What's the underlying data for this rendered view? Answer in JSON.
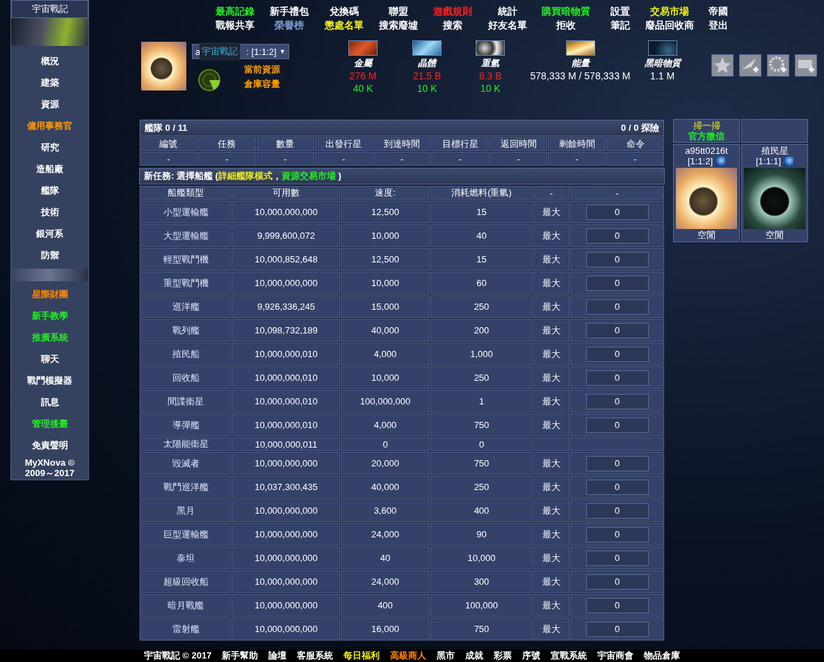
{
  "sidebar": {
    "title": "宇宙戰記",
    "items": [
      {
        "label": "概況",
        "color": "#ffffff"
      },
      {
        "label": "建築",
        "color": "#ffffff"
      },
      {
        "label": "資源",
        "color": "#ffffff"
      },
      {
        "label": "傭用事務官",
        "color": "#ff9900"
      },
      {
        "label": "研究",
        "color": "#ffffff"
      },
      {
        "label": "造船廠",
        "color": "#ffffff"
      },
      {
        "label": "艦隊",
        "color": "#ffffff"
      },
      {
        "label": "技術",
        "color": "#ffffff"
      },
      {
        "label": "銀河系",
        "color": "#ffffff"
      },
      {
        "label": "防禦",
        "color": "#ffffff"
      }
    ],
    "items_2": [
      {
        "label": "星際財團",
        "color": "#ff8800"
      },
      {
        "label": "新手教學",
        "color": "#22ee22"
      },
      {
        "label": "推廣系統",
        "color": "#22ee22"
      },
      {
        "label": "聊天",
        "color": "#ffffff"
      },
      {
        "label": "戰鬥模擬器",
        "color": "#ffffff"
      },
      {
        "label": "訊息",
        "color": "#ffffff"
      },
      {
        "label": "管理後臺",
        "color": "#22ee22"
      },
      {
        "label": "免責聲明",
        "color": "#ffffff"
      }
    ],
    "copyright": [
      "MyXNova ©",
      "2009～2017"
    ]
  },
  "top_nav": [
    [
      {
        "label": "最高記錄",
        "color": "#22ee22"
      },
      {
        "label": "新手禮包",
        "color": "#ffffff"
      },
      {
        "label": "兌換碼",
        "color": "#ffffff"
      },
      {
        "label": "聯盟",
        "color": "#ffffff"
      },
      {
        "label": "遊戲規則",
        "color": "#ff2222"
      },
      {
        "label": "統計",
        "color": "#ffffff"
      },
      {
        "label": "購買暗物質",
        "color": "#22ee22"
      },
      {
        "label": "設置",
        "color": "#ffffff"
      },
      {
        "label": "交易市場",
        "color": "#eeee22"
      },
      {
        "label": "帝國",
        "color": "#ffffff"
      }
    ],
    [
      {
        "label": "戰報共享",
        "color": "#ffffff"
      },
      {
        "label": "榮譽榜",
        "color": "#7799cc"
      },
      {
        "label": "懲處名單",
        "color": "#eeee22"
      },
      {
        "label": "搜索廢墟",
        "color": "#ffffff"
      },
      {
        "label": "搜索",
        "color": "#ffffff"
      },
      {
        "label": "好友名單",
        "color": "#ffffff"
      },
      {
        "label": "拒收",
        "color": "#ffffff"
      },
      {
        "label": "筆記",
        "color": "#ffffff"
      },
      {
        "label": "廢品回收商",
        "color": "#ffffff"
      },
      {
        "label": "登出",
        "color": "#ffffff"
      }
    ]
  ],
  "planet_select": {
    "value_start": "a",
    "value_end": ": [1:1:2]",
    "caret": "▼",
    "tooltip": "宇宙戰記"
  },
  "resource_labels": [
    "當前資源",
    "倉庫容量"
  ],
  "resources": [
    {
      "kind": "metal",
      "name": "金屬",
      "amount": "276 M",
      "over_capacity": true,
      "capacity": "40 K"
    },
    {
      "kind": "crystal",
      "name": "晶體",
      "amount": "21.5 B",
      "over_capacity": true,
      "capacity": "10 K"
    },
    {
      "kind": "deuterium",
      "name": "重氫",
      "amount": "8.3 B",
      "over_capacity": true,
      "capacity": "10 K"
    },
    {
      "kind": "energy",
      "name": "能量",
      "amount": "578,333 M / 578,333 M",
      "over_capacity": false
    },
    {
      "kind": "darkmatter",
      "name": "黑暗物質",
      "amount": "1.1 M",
      "over_capacity": false
    }
  ],
  "fleet": {
    "title": "艦隊 0 / 11",
    "expeditions": "0 / 0 探險",
    "columns": [
      "編號",
      "任務",
      "數量",
      "出發行星",
      "到達時間",
      "目標行星",
      "返回時間",
      "剩餘時間",
      "命令"
    ],
    "row": [
      "-",
      "-",
      "-",
      "-",
      "-",
      "-",
      "-",
      "-",
      "-"
    ]
  },
  "new_mission": {
    "label": "新任務: 選擇船艦 (",
    "link_1": "詳細艦隊模式",
    "separator": "，",
    "link_2": "資源交易市場",
    "end": ")"
  },
  "ships": {
    "columns": [
      "船艦類型",
      "可用數",
      "速度:",
      "消耗燃料(重氫)",
      "-",
      "-"
    ],
    "rows": [
      {
        "kind": "input",
        "name": "小型運輸艦",
        "available": "10,000,000,000",
        "speed": "12,500",
        "fuel": "15",
        "max": "最大",
        "value": "0"
      },
      {
        "kind": "input",
        "name": "大型運輸艦",
        "available": "9,999,600,072",
        "speed": "10,000",
        "fuel": "40",
        "max": "最大",
        "value": "0"
      },
      {
        "kind": "input",
        "name": "輕型戰鬥機",
        "available": "10,000,852,648",
        "speed": "12,500",
        "fuel": "15",
        "max": "最大",
        "value": "0"
      },
      {
        "kind": "input",
        "name": "重型戰鬥機",
        "available": "10,000,000,000",
        "speed": "10,000",
        "fuel": "60",
        "max": "最大",
        "value": "0"
      },
      {
        "kind": "input",
        "name": "巡洋艦",
        "available": "9,926,336,245",
        "speed": "15,000",
        "fuel": "250",
        "max": "最大",
        "value": "0"
      },
      {
        "kind": "input",
        "name": "戰列艦",
        "available": "10,098,732,189",
        "speed": "40,000",
        "fuel": "200",
        "max": "最大",
        "value": "0"
      },
      {
        "kind": "input",
        "name": "殖民船",
        "available": "10,000,000,010",
        "speed": "4,000",
        "fuel": "1,000",
        "max": "最大",
        "value": "0"
      },
      {
        "kind": "input",
        "name": "回收船",
        "available": "10,000,000,010",
        "speed": "10,000",
        "fuel": "250",
        "max": "最大",
        "value": "0"
      },
      {
        "kind": "input",
        "name": "間諜衛星",
        "available": "10,000,000,010",
        "speed": "100,000,000",
        "fuel": "1",
        "max": "最大",
        "value": "0"
      },
      {
        "kind": "input",
        "name": "導彈艦",
        "available": "10,000,000,010",
        "speed": "4,000",
        "fuel": "750",
        "max": "最大",
        "value": "0"
      },
      {
        "kind": "static",
        "name": "太陽能衛星",
        "available": "10,000,000,011",
        "speed": "0",
        "fuel": "0"
      },
      {
        "kind": "input",
        "name": "毀滅者",
        "available": "10,000,000,000",
        "speed": "20,000",
        "fuel": "750",
        "max": "最大",
        "value": "0"
      },
      {
        "kind": "input",
        "name": "戰鬥巡洋艦",
        "available": "10,037,300,435",
        "speed": "40,000",
        "fuel": "250",
        "max": "最大",
        "value": "0"
      },
      {
        "kind": "input",
        "name": "黑月",
        "available": "10,000,000,000",
        "speed": "3,600",
        "fuel": "400",
        "max": "最大",
        "value": "0"
      },
      {
        "kind": "input",
        "name": "巨型運輸艦",
        "available": "10,000,000,000",
        "speed": "24,000",
        "fuel": "90",
        "max": "最大",
        "value": "0"
      },
      {
        "kind": "input",
        "name": "泰坦",
        "available": "10,000,000,000",
        "speed": "40",
        "fuel": "10,000",
        "max": "最大",
        "value": "0"
      },
      {
        "kind": "input",
        "name": "超級回收船",
        "available": "10,000,000,000",
        "speed": "24,000",
        "fuel": "300",
        "max": "最大",
        "value": "0"
      },
      {
        "kind": "input",
        "name": "暗月戰艦",
        "available": "10,000,000,000",
        "speed": "400",
        "fuel": "100,000",
        "max": "最大",
        "value": "0"
      },
      {
        "kind": "input",
        "name": "雷射艦",
        "available": "10,000,000,000",
        "speed": "16,000",
        "fuel": "750",
        "max": "最大",
        "value": "0"
      }
    ]
  },
  "wechat": {
    "line_1": "掃一掃",
    "line_2": "官方微信"
  },
  "planets": [
    {
      "kind": "desert",
      "name": "a95tt0216t",
      "coords": "[1:1:2]",
      "status": "空閒"
    },
    {
      "kind": "dark",
      "name": "殖民星",
      "coords": "[1:1:1]",
      "status": "空閒"
    }
  ],
  "footer": [
    {
      "label": "宇宙戰記 © 2017",
      "color": "#ffffff"
    },
    {
      "label": "新手幫助",
      "color": "#ffffff"
    },
    {
      "label": "論壇",
      "color": "#ffffff"
    },
    {
      "label": "客服系統",
      "color": "#ffffff"
    },
    {
      "label": "每日福利",
      "color": "#eeee22"
    },
    {
      "label": "高級商人",
      "color": "#ff8800"
    },
    {
      "label": "黑市",
      "color": "#ffffff"
    },
    {
      "label": "成就",
      "color": "#ffffff"
    },
    {
      "label": "彩票",
      "color": "#ffffff"
    },
    {
      "label": "序號",
      "color": "#ffffff"
    },
    {
      "label": "宣戰系統",
      "color": "#ffffff"
    },
    {
      "label": "宇宙商會",
      "color": "#ffffff"
    },
    {
      "label": "物品倉庫",
      "color": "#ffffff"
    }
  ]
}
